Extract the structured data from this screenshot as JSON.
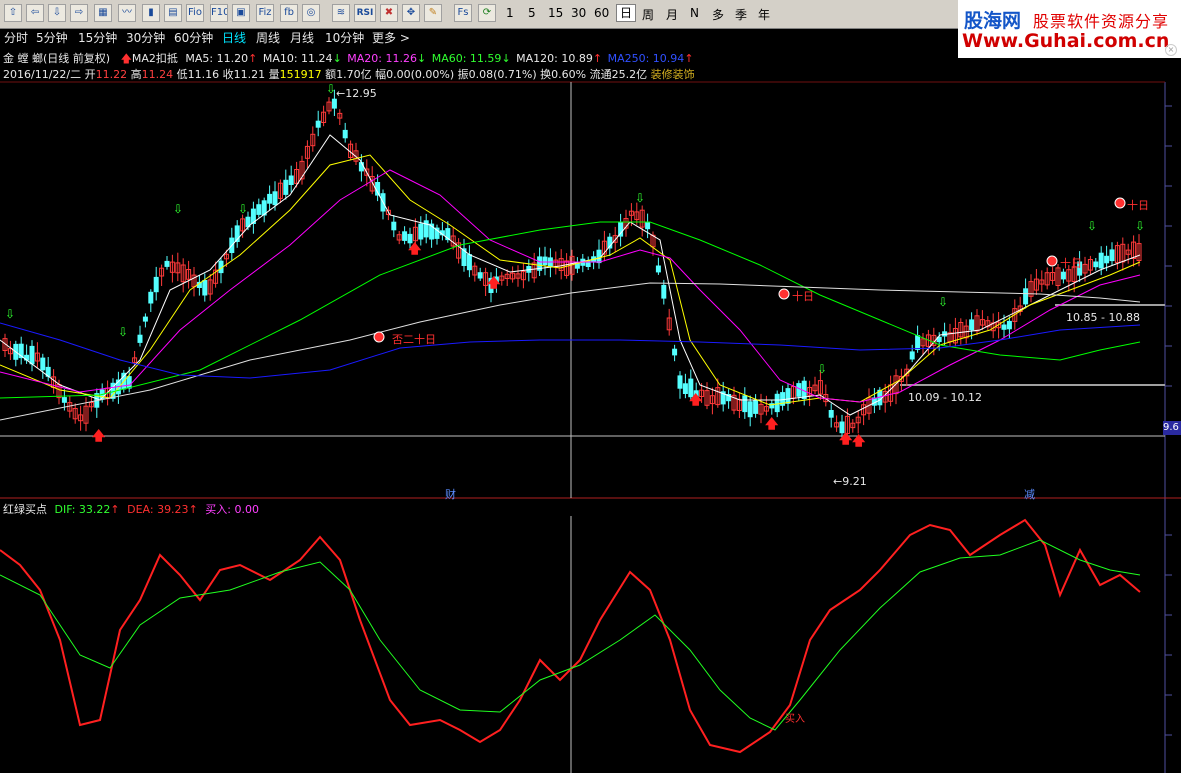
{
  "toolbar": {
    "icons": [
      "arrow-up-icon",
      "arrow-left-icon",
      "arrow-down-icon",
      "arrow-right-icon",
      "table-icon",
      "line-chart-icon",
      "candlestick-icon",
      "grid-icon",
      "fio-icon",
      "f10-icon",
      "fiz-icon",
      "fb-icon",
      "circle-icon",
      "wave-icon",
      "rsi-icon",
      "tools-icon",
      "move-icon",
      "pen-icon",
      "fs-icon",
      "refresh-icon"
    ],
    "fio": "Fio",
    "f10": "F10",
    "fiz": "Fiz",
    "rsi": "RSI",
    "fs": "Fs",
    "minutes": [
      "1",
      "5",
      "15",
      "30",
      "60"
    ],
    "periods": [
      "日",
      "周",
      "月",
      "N",
      "多",
      "季",
      "年"
    ],
    "active_period": "日"
  },
  "logo": {
    "brand": "股海网",
    "slogan": "股票软件资源分享",
    "url": "Www.Guhai.com.cn"
  },
  "period_tabs": [
    "分时",
    "5分钟",
    "15分钟",
    "30分钟",
    "60分钟",
    "日线",
    "周线",
    "月线",
    "10分钟",
    "更多 >"
  ],
  "selected_tab": "日线",
  "info": {
    "stock": "金 螳 螂(日线 前复权)",
    "ma_signal": "MA2扣抵",
    "ma5": "MA5: 11.20",
    "ma10": "MA10: 11.24",
    "ma20": "MA20: 11.26",
    "ma60": "MA60: 11.59",
    "ma120": "MA120: 10.89",
    "ma250": "MA250: 10.94",
    "date": "2016/11/22/二",
    "open_l": "开",
    "open": "11.22",
    "high_l": "高",
    "high": "11.24",
    "low_l": "低",
    "low": "11.16",
    "close_l": "收",
    "close": "11.21",
    "vol_l": "量",
    "vol": "151917",
    "amount": "额1.70亿",
    "change": "幅0.00(0.00%)",
    "amplitude": "振0.08(0.71%)",
    "turnover": "换0.60%",
    "float": "流通25.2亿",
    "sector": "装修装饰"
  },
  "main_annotations": {
    "high": "12.95",
    "low": "9.21",
    "range1": "10.09 - 10.12",
    "range2": "10.85 - 10.88",
    "price_tag": "9.6",
    "label_cai": "财",
    "label_jian": "减",
    "tag1": "否二十日",
    "tag2": "十日",
    "tag3": "十日",
    "tag4": "十日"
  },
  "indicator": {
    "name": "红绿买点",
    "dif": "DIF: 33.22",
    "dea": "DEA: 39.23",
    "buy": "买入: 0.00",
    "buy_mark": "买入"
  },
  "colors": {
    "up": "#ff3a3a",
    "down": "#54ffff",
    "ma5": "#ffffff",
    "ma10": "#ffff00",
    "ma20": "#ff00ff",
    "ma60": "#00ff00",
    "ma120": "#e0e0e0",
    "ma250": "#1a1aff",
    "dif": "#ff2020",
    "dea": "#20ff20"
  }
}
